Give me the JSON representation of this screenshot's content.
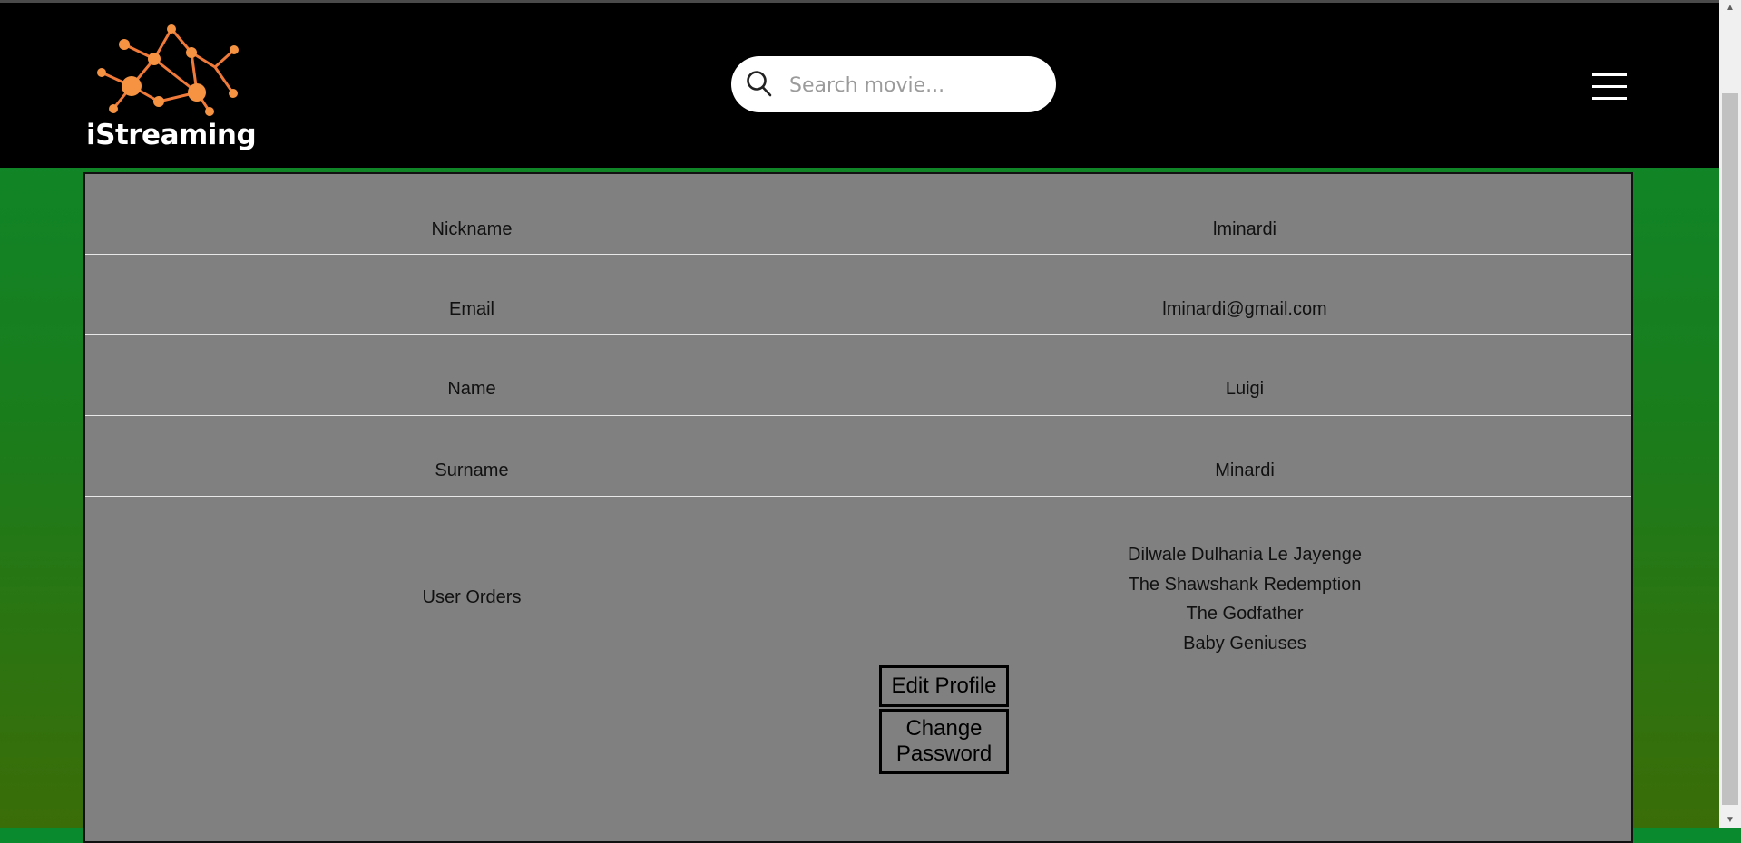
{
  "header": {
    "logo_text": "iStreaming",
    "search": {
      "placeholder": "Search movie...",
      "icon": "search-icon"
    },
    "menu_icon": "hamburger-menu-icon"
  },
  "profile": {
    "rows": [
      {
        "label": "Nickname",
        "value": "lminardi"
      },
      {
        "label": "Email",
        "value": "lminardi@gmail.com"
      },
      {
        "label": "Name",
        "value": "Luigi"
      },
      {
        "label": "Surname",
        "value": "Minardi"
      }
    ],
    "orders_label": "User Orders",
    "orders": [
      "Dilwale Dulhania Le Jayenge",
      "The Shawshank Redemption",
      "The Godfather",
      "Baby Geniuses"
    ],
    "edit_button": "Edit Profile",
    "change_password_button": "Change Password"
  },
  "colors": {
    "header_bg": "#000000",
    "panel_bg": "#808080",
    "logo_accent": "#f59342",
    "page_gradient_top": "#0a8a2e",
    "page_gradient_bottom": "#3a6d08"
  }
}
